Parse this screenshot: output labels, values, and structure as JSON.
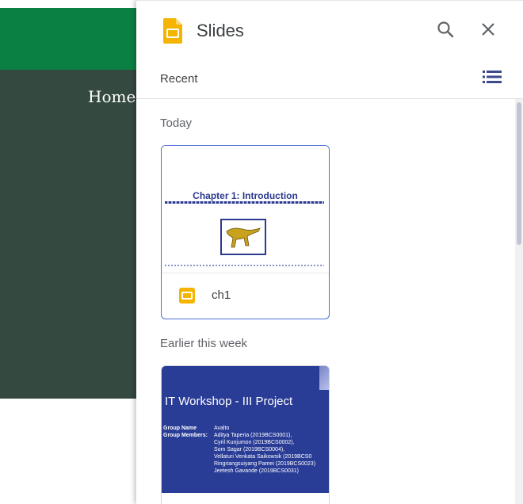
{
  "background": {
    "home_link": "Home",
    "colors": {
      "topbar": "#0b8043",
      "hero": "#34493f"
    }
  },
  "panel": {
    "app_title": "Slides",
    "icons": {
      "app": "google-slides-icon",
      "search": "search-icon",
      "close": "close-icon",
      "list_view": "list-view-icon"
    },
    "recent_label": "Recent",
    "sections": [
      {
        "label": "Today",
        "files": [
          {
            "name": "ch1",
            "thumbnail_title": "Chapter 1:  Introduction"
          }
        ]
      },
      {
        "label": "Earlier this week",
        "files": [
          {
            "name": "",
            "thumbnail_title": "IT Workshop - III Project",
            "group_name_label": "Group Name",
            "group_name_value": "Avalto",
            "group_members_label": "Group Members:",
            "members": [
              "Aditya Taperia (2019BCS0001),",
              "Cyril Kunjumon (2019BCS0002),",
              "Som Sagar (2019BCS0004),",
              "Vellaturi Venkata Saikowsik (2019BCS0",
              "Ringriangsuiyang Pamei (2019BCS0023)",
              "Jeetesh Gavande (2019BCS0031)"
            ]
          }
        ]
      }
    ],
    "colors": {
      "accent": "#4a6dd8",
      "slides_yellow": "#f4b400",
      "slide_blue": "#293c96"
    }
  }
}
